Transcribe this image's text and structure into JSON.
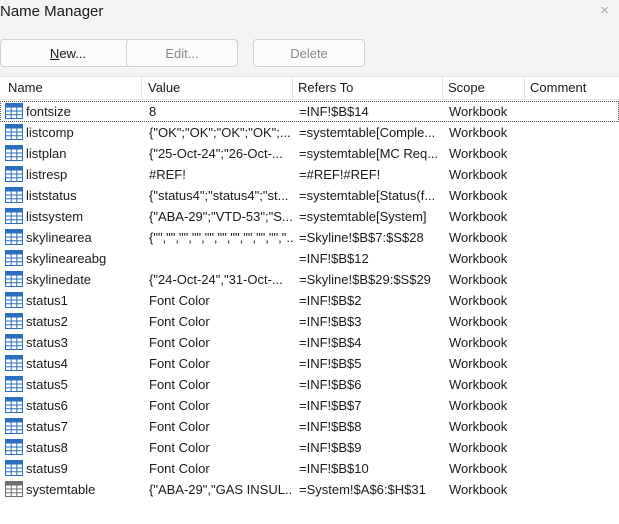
{
  "window": {
    "title": "Name Manager",
    "close_glyph": "×"
  },
  "toolbar": {
    "new_underlined": "N",
    "new_rest": "ew...",
    "edit_label": "Edit...",
    "delete_label": "Delete"
  },
  "columns": [
    "Name",
    "Value",
    "Refers To",
    "Scope",
    "Comment"
  ],
  "colors": {
    "icon_blue": "#2a6fc0",
    "icon_gray": "#6e6e6e"
  },
  "rows": [
    {
      "icon": "named-range-icon",
      "name": "fontsize",
      "value": "8",
      "refers_to": "=INF!$B$14",
      "scope": "Workbook",
      "comment": ""
    },
    {
      "icon": "named-range-icon",
      "name": "listcomp",
      "value": "{\"OK\";\"OK\";\"OK\";\"OK\";...",
      "refers_to": "=systemtable[Comple...",
      "scope": "Workbook",
      "comment": ""
    },
    {
      "icon": "named-range-icon",
      "name": "listplan",
      "value": "{\"25-Oct-24\";\"26-Oct-...",
      "refers_to": "=systemtable[MC Req...",
      "scope": "Workbook",
      "comment": ""
    },
    {
      "icon": "named-range-icon",
      "name": "listresp",
      "value": "#REF!",
      "refers_to": "=#REF!#REF!",
      "scope": "Workbook",
      "comment": ""
    },
    {
      "icon": "named-range-icon",
      "name": "liststatus",
      "value": "{\"status4\";\"status4\";\"st...",
      "refers_to": "=systemtable[Status(f...",
      "scope": "Workbook",
      "comment": ""
    },
    {
      "icon": "named-range-icon",
      "name": "listsystem",
      "value": "{\"ABA-29\";\"VTD-53\";\"S...",
      "refers_to": "=systemtable[System]",
      "scope": "Workbook",
      "comment": ""
    },
    {
      "icon": "named-range-icon",
      "name": "skylinearea",
      "value": "{\"\",\"\",\"\",\"\",\"\",\"\",\"\",\"\",\"\",\"\",\"...",
      "refers_to": "=Skyline!$B$7:$S$28",
      "scope": "Workbook",
      "comment": ""
    },
    {
      "icon": "named-range-icon",
      "name": "skylineareabg",
      "value": "",
      "refers_to": "=INF!$B$12",
      "scope": "Workbook",
      "comment": ""
    },
    {
      "icon": "named-range-icon",
      "name": "skylinedate",
      "value": "{\"24-Oct-24\",\"31-Oct-...",
      "refers_to": "=Skyline!$B$29:$S$29",
      "scope": "Workbook",
      "comment": ""
    },
    {
      "icon": "named-range-icon",
      "name": "status1",
      "value": "Font Color",
      "refers_to": "=INF!$B$2",
      "scope": "Workbook",
      "comment": ""
    },
    {
      "icon": "named-range-icon",
      "name": "status2",
      "value": "Font Color",
      "refers_to": "=INF!$B$3",
      "scope": "Workbook",
      "comment": ""
    },
    {
      "icon": "named-range-icon",
      "name": "status3",
      "value": "Font Color",
      "refers_to": "=INF!$B$4",
      "scope": "Workbook",
      "comment": ""
    },
    {
      "icon": "named-range-icon",
      "name": "status4",
      "value": "Font Color",
      "refers_to": "=INF!$B$5",
      "scope": "Workbook",
      "comment": ""
    },
    {
      "icon": "named-range-icon",
      "name": "status5",
      "value": "Font Color",
      "refers_to": "=INF!$B$6",
      "scope": "Workbook",
      "comment": ""
    },
    {
      "icon": "named-range-icon",
      "name": "status6",
      "value": "Font Color",
      "refers_to": "=INF!$B$7",
      "scope": "Workbook",
      "comment": ""
    },
    {
      "icon": "named-range-icon",
      "name": "status7",
      "value": "Font Color",
      "refers_to": "=INF!$B$8",
      "scope": "Workbook",
      "comment": ""
    },
    {
      "icon": "named-range-icon",
      "name": "status8",
      "value": "Font Color",
      "refers_to": "=INF!$B$9",
      "scope": "Workbook",
      "comment": ""
    },
    {
      "icon": "named-range-icon",
      "name": "status9",
      "value": "Font Color",
      "refers_to": "=INF!$B$10",
      "scope": "Workbook",
      "comment": ""
    },
    {
      "icon": "table-icon",
      "name": "systemtable",
      "value": "{\"ABA-29\",\"GAS INSUL...",
      "refers_to": "=System!$A$6:$H$31",
      "scope": "Workbook",
      "comment": ""
    }
  ]
}
